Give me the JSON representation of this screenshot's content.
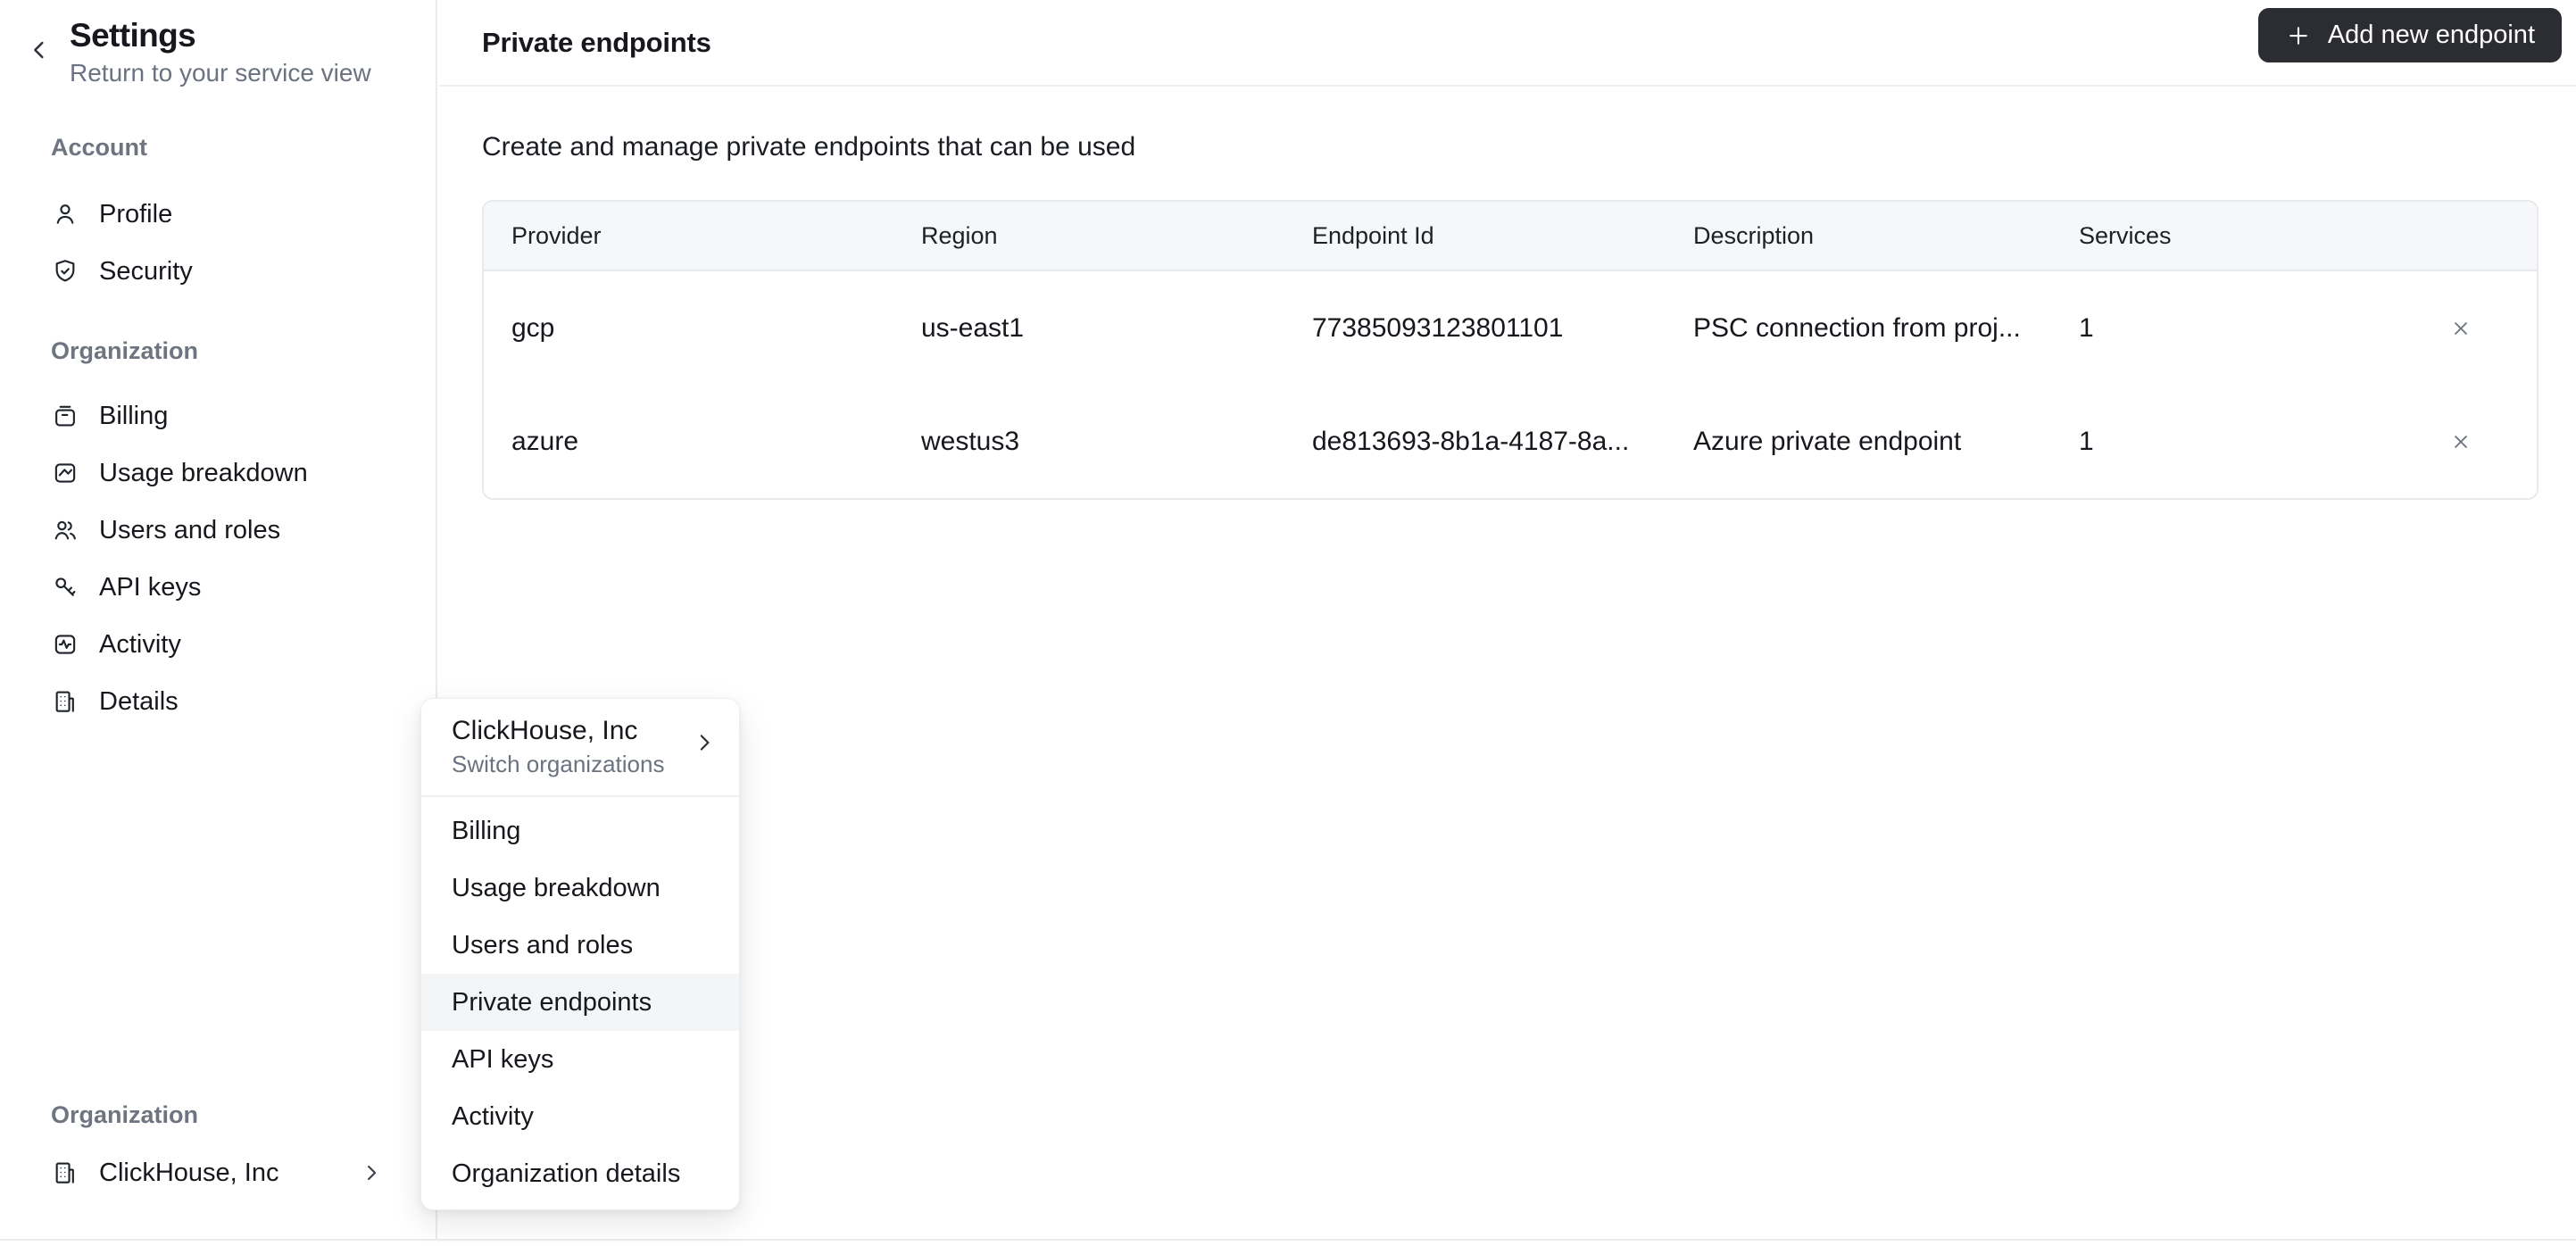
{
  "colors": {
    "button_dark": "#2b2d33",
    "table_header_bg": "#f6f7f9",
    "menu_highlight_bg": "#f4f5f6",
    "border": "#e7e9ec",
    "text_primary": "#16181d",
    "text_secondary": "#6b7280"
  },
  "sidebar": {
    "back_icon": "chevron-left-icon",
    "title": "Settings",
    "subtitle": "Return to your service view",
    "account_section_label": "Account",
    "account_items": [
      {
        "label": "Profile",
        "icon": "user-icon"
      },
      {
        "label": "Security",
        "icon": "shield-check-icon"
      }
    ],
    "organization_section_label": "Organization",
    "organization_items": [
      {
        "label": "Billing",
        "icon": "billing-icon"
      },
      {
        "label": "Usage breakdown",
        "icon": "usage-chart-icon"
      },
      {
        "label": "Users and roles",
        "icon": "users-icon"
      },
      {
        "label": "API keys",
        "icon": "key-icon"
      },
      {
        "label": "Activity",
        "icon": "activity-icon"
      },
      {
        "label": "Details",
        "icon": "building-icon"
      }
    ],
    "footer": {
      "section_label": "Organization",
      "org_name": "ClickHouse, Inc",
      "icon": "building-icon",
      "chevron_icon": "chevron-right-icon"
    }
  },
  "header": {
    "title": "Private endpoints",
    "add_button": {
      "label": "Add new endpoint",
      "icon": "plus-icon"
    }
  },
  "main": {
    "description": "Create and manage private endpoints that can be used",
    "table": {
      "columns": [
        "Provider",
        "Region",
        "Endpoint Id",
        "Description",
        "Services"
      ],
      "row_action_icon": "x-icon",
      "rows": [
        {
          "provider": "gcp",
          "region": "us-east1",
          "endpoint_id": "77385093123801101",
          "description": "PSC connection from proj...",
          "services": "1"
        },
        {
          "provider": "azure",
          "region": "westus3",
          "endpoint_id": "de813693-8b1a-4187-8a...",
          "description": "Azure private endpoint",
          "services": "1"
        }
      ]
    }
  },
  "context_menu": {
    "header": {
      "title": "ClickHouse, Inc",
      "subtitle": "Switch organizations",
      "chevron_icon": "chevron-right-icon"
    },
    "active_item": "Private endpoints",
    "items": [
      {
        "label": "Billing"
      },
      {
        "label": "Usage breakdown"
      },
      {
        "label": "Users and roles"
      },
      {
        "label": "Private endpoints"
      },
      {
        "label": "API keys"
      },
      {
        "label": "Activity"
      },
      {
        "label": "Organization details"
      }
    ]
  }
}
